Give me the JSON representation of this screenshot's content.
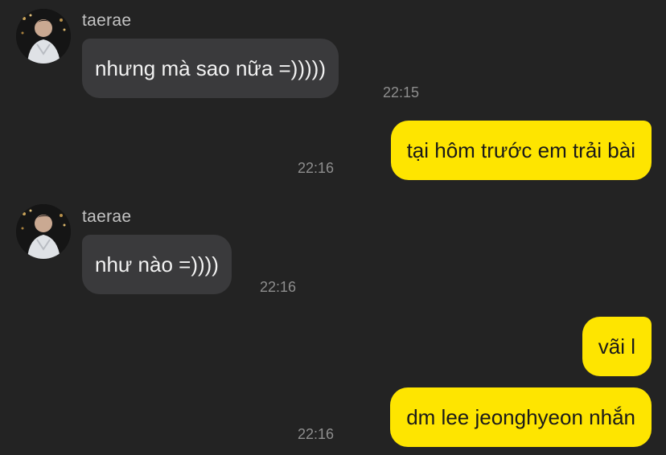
{
  "messages": [
    {
      "sender": "taerae",
      "text": "nhưng mà sao nữa =)))))",
      "time": "22:15"
    },
    {
      "text": "tại hôm trước em trải bài",
      "time": "22:16"
    },
    {
      "sender": "taerae",
      "text": "như nào =))))",
      "time": "22:16"
    },
    {
      "text": "vãi l"
    },
    {
      "text": "dm lee jeonghyeon nhắn",
      "time": "22:16"
    }
  ],
  "colors": {
    "background": "#232323",
    "incoming_bubble": "#3a3a3c",
    "outgoing_bubble": "#fee500"
  }
}
